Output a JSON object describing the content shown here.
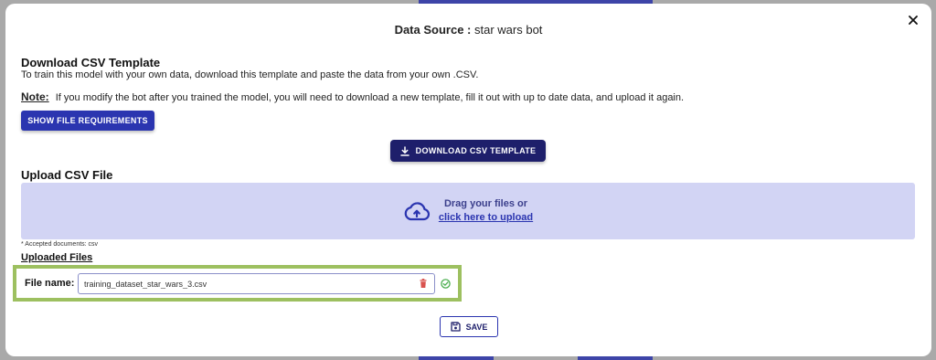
{
  "modal": {
    "title_label": "Data Source :",
    "title_value": "star wars bot"
  },
  "download_section": {
    "title": "Download CSV Template",
    "description": "To train this model with your own data, download this template and paste the data from your own .CSV.",
    "note_label": "Note:",
    "note_text": "If you modify the bot after you trained the model, you will need to download a new template, fill it out with up to date data, and upload it again.",
    "requirements_button": "SHOW FILE REQUIREMENTS",
    "download_button": "DOWNLOAD CSV TEMPLATE"
  },
  "upload_section": {
    "title": "Upload CSV File",
    "drag_text": "Drag your files or",
    "upload_link": "click here to upload",
    "accepted_note": "* Accepted documents: csv"
  },
  "uploaded_files": {
    "title": "Uploaded Files",
    "file_label": "File name:",
    "file_name": "training_dataset_star_wars_3.csv"
  },
  "footer": {
    "save_button": "SAVE"
  },
  "icons": {
    "close": "close-icon",
    "download": "download-icon",
    "upload": "cloud-upload-icon",
    "trash": "trash-icon",
    "check": "check-circle-icon",
    "save": "save-icon"
  },
  "colors": {
    "primary": "#2b35b0",
    "dark_primary": "#1e1f6b",
    "dropzone": "#d2d4f4",
    "highlight": "#9dc060",
    "trash": "#d9534f",
    "check": "#4caf50"
  }
}
